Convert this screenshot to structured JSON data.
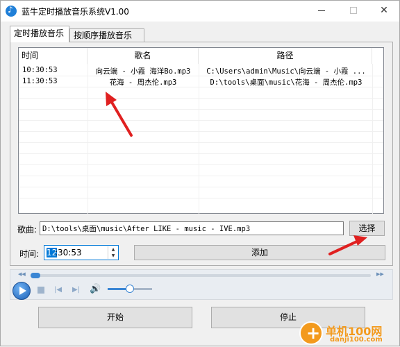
{
  "window": {
    "title": "蓝牛定时播放音乐系统V1.00",
    "minimize": "",
    "maximize": "",
    "close": "✕"
  },
  "tabs": [
    {
      "label": "定时播放音乐",
      "active": true
    },
    {
      "label": "按顺序播放音乐",
      "active": false
    }
  ],
  "table": {
    "columns": [
      "时间",
      "歌名",
      "路径"
    ],
    "rows": [
      {
        "time": "10:30:53",
        "song": "向云端 - 小霞 海洋Bo.mp3",
        "path": "C:\\Users\\admin\\Music\\向云端 - 小霞 ..."
      },
      {
        "time": "11:30:53",
        "song": "花海 - 周杰伦.mp3",
        "path": "D:\\tools\\桌面\\music\\花海 - 周杰伦.mp3"
      }
    ]
  },
  "song_field": {
    "label": "歌曲:",
    "value": "D:\\tools\\桌面\\music\\After LIKE - music - IVE.mp3",
    "select_label": "选择"
  },
  "time_field": {
    "label": "时间:",
    "hour": "12",
    "rest": ":30:53",
    "add_label": "添加"
  },
  "player": {
    "seek_position": 0.0,
    "volume": 0.5
  },
  "buttons": {
    "start": "开始",
    "stop": "停止"
  },
  "watermark": {
    "line1": "单机100网",
    "line2": "danji100.com"
  },
  "colors": {
    "accent": "#0078d7",
    "arrow": "#e02020",
    "watermark": "#f39a1d"
  }
}
